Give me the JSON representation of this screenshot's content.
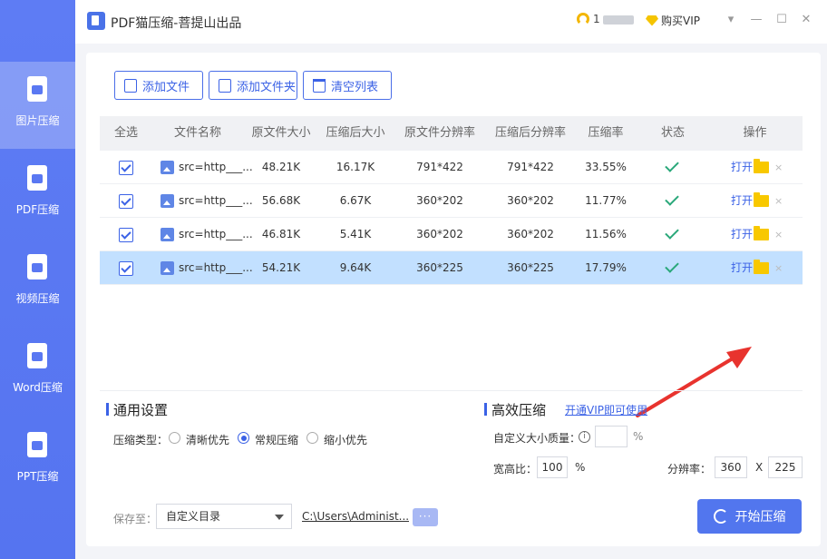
{
  "app": {
    "title": "PDF猫压缩-菩提山出品"
  },
  "header": {
    "user_name": "1",
    "vip_label": "购买VIP",
    "controls": [
      "▾",
      "—",
      "☐",
      "✕"
    ]
  },
  "sidebar": {
    "items": [
      {
        "label": "图片压缩",
        "icon": "image-file-icon",
        "active": true
      },
      {
        "label": "PDF压缩",
        "icon": "pdf-file-icon",
        "active": false
      },
      {
        "label": "视频压缩",
        "icon": "video-file-icon",
        "active": false
      },
      {
        "label": "Word压缩",
        "icon": "word-file-icon",
        "active": false
      },
      {
        "label": "PPT压缩",
        "icon": "ppt-file-icon",
        "active": false
      }
    ]
  },
  "toolbar": {
    "add_file": "添加文件",
    "add_folder": "添加文件夹",
    "clear_list": "清空列表"
  },
  "table": {
    "headers": [
      "全选",
      "文件名称",
      "原文件大小",
      "压缩后大小",
      "原文件分辨率",
      "压缩后分辨率",
      "压缩率",
      "状态",
      "操作"
    ],
    "rows": [
      {
        "name": "src=http___...",
        "orig_size": "48.21K",
        "comp_size": "16.17K",
        "orig_res": "791*422",
        "comp_res": "791*422",
        "ratio": "33.55%",
        "open": "打开",
        "del": "×",
        "selected": false
      },
      {
        "name": "src=http___...",
        "orig_size": "56.68K",
        "comp_size": "6.67K",
        "orig_res": "360*202",
        "comp_res": "360*202",
        "ratio": "11.77%",
        "open": "打开",
        "del": "×",
        "selected": false
      },
      {
        "name": "src=http___...",
        "orig_size": "46.81K",
        "comp_size": "5.41K",
        "orig_res": "360*202",
        "comp_res": "360*202",
        "ratio": "11.56%",
        "open": "打开",
        "del": "×",
        "selected": false
      },
      {
        "name": "src=http___...",
        "orig_size": "54.21K",
        "comp_size": "9.64K",
        "orig_res": "360*225",
        "comp_res": "360*225",
        "ratio": "17.79%",
        "open": "打开",
        "del": "×",
        "selected": true
      }
    ]
  },
  "settings": {
    "general_title": "通用设置",
    "type_label": "压缩类型：",
    "options": [
      "清晰优先",
      "常规压缩",
      "缩小优先"
    ],
    "selected_option": "常规压缩",
    "efficient_title": "高效压缩",
    "vip_link": "开通VIP即可使用",
    "custom_quality_label": "自定义大小质量：",
    "custom_quality_value": "",
    "percent": "%",
    "aspect_label": "宽高比：",
    "aspect_value": "100",
    "resolution_label": "分辨率：",
    "res_w": "360",
    "res_x": "X",
    "res_h": "225"
  },
  "footer": {
    "save_label": "保存至：",
    "save_option": "自定义目录",
    "path": "C:\\Users\\Administ...",
    "more": "···",
    "start": "开始压缩"
  },
  "colors": {
    "accent": "#4a6ee8",
    "sidebar": "#5a78f2",
    "selected_row": "#c2e0ff",
    "success": "#2aa87a",
    "arrow": "#e8332e"
  }
}
